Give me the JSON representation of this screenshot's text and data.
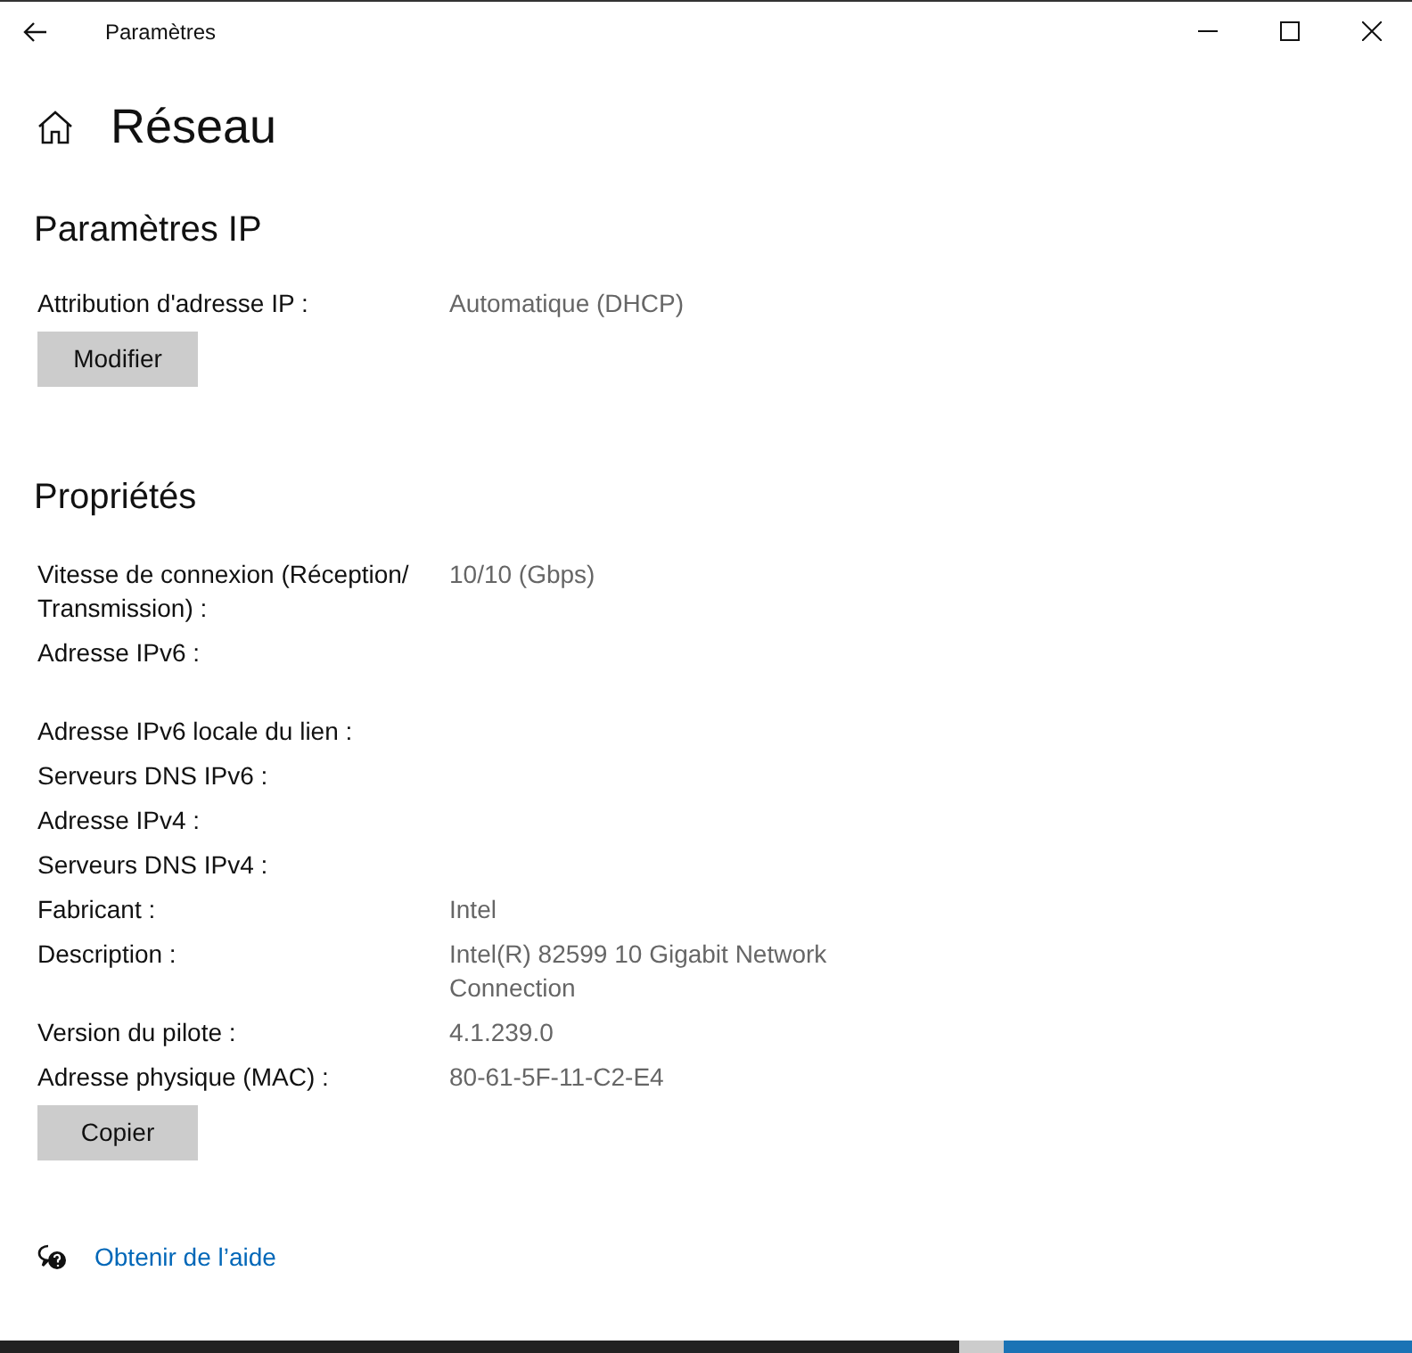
{
  "window": {
    "title": "Paramètres"
  },
  "page": {
    "title": "Réseau"
  },
  "ip_settings": {
    "heading": "Paramètres IP",
    "label": "Attribution d'adresse IP :",
    "value": "Automatique (DHCP)",
    "button": "Modifier"
  },
  "properties": {
    "heading": "Propriétés",
    "rows": [
      {
        "kind": "line",
        "label": "Vitesse de connexion (Réception/ Transmission) :",
        "value": "10/10 (Gbps)"
      },
      {
        "kind": "tall",
        "label": "Adresse IPv6 :"
      },
      {
        "kind": "line",
        "label": "Adresse IPv6 locale du lien :"
      },
      {
        "kind": "line",
        "label": "Serveurs DNS IPv6 :"
      },
      {
        "kind": "line",
        "label": "Adresse IPv4 :"
      },
      {
        "kind": "line",
        "label": "Serveurs DNS IPv4 :"
      },
      {
        "kind": "line",
        "label": "Fabricant :",
        "value": "Intel"
      },
      {
        "kind": "line",
        "label": "Description :",
        "value": "Intel(R) 82599 10 Gigabit Network Connection"
      },
      {
        "kind": "line",
        "label": "Version du pilote :",
        "value": "4.1.239.0"
      },
      {
        "kind": "line",
        "label": "Adresse physique (MAC) :",
        "value": "80-61-5F-11-C2-E4"
      }
    ],
    "button": "Copier"
  },
  "help_link": "Obtenir de l’aide"
}
